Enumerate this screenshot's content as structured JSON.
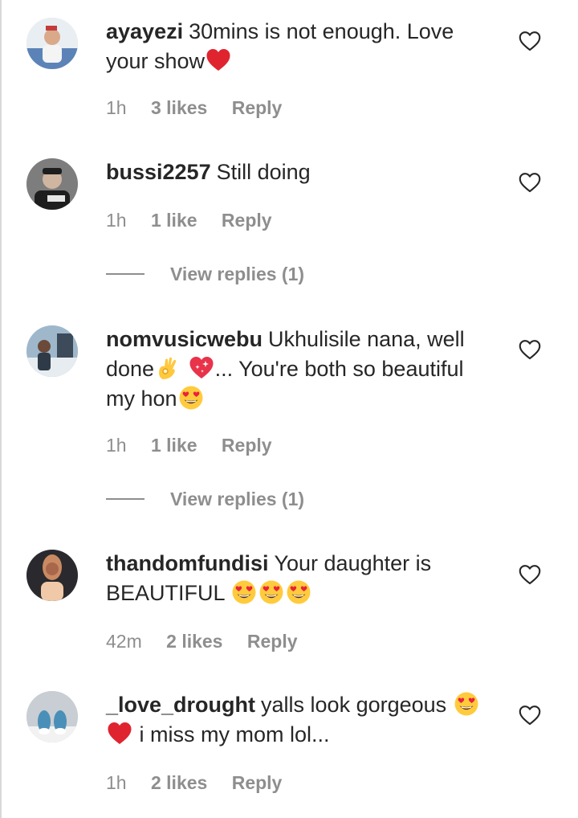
{
  "comments": [
    {
      "username": "ayayezi",
      "text_parts": [
        "30mins is not enough. Love your show"
      ],
      "time": "1h",
      "likes": "3 likes",
      "reply": "Reply",
      "avatar_colors": [
        "#e9eef3",
        "#c43b3b",
        "#5c83b8"
      ]
    },
    {
      "username": "bussi2257",
      "text_parts": [
        "Still doing"
      ],
      "time": "1h",
      "likes": "1 like",
      "reply": "Reply",
      "view_replies": "View replies (1)",
      "avatar_colors": [
        "#7d7d7d",
        "#1e1e1e",
        "#e6e6e6"
      ]
    },
    {
      "username": "nomvusicwebu",
      "text_parts": [
        "Ukhulisile nana, well done",
        "... You're both so beautiful my hon"
      ],
      "time": "1h",
      "likes": "1 like",
      "reply": "Reply",
      "view_replies": "View replies (1)",
      "avatar_colors": [
        "#9fb7cb",
        "#3d4a5a",
        "#e7ecf0"
      ]
    },
    {
      "username": "thandomfundisi",
      "text_parts": [
        "Your daughter is BEAUTIFUL"
      ],
      "time": "42m",
      "likes": "2 likes",
      "reply": "Reply",
      "avatar_colors": [
        "#2a2a2e",
        "#c98a63",
        "#f0c9a8"
      ]
    },
    {
      "username": "_love_drought",
      "text_parts": [
        "yalls look gorgeous",
        "i miss my mom lol..."
      ],
      "time": "1h",
      "likes": "2 likes",
      "reply": "Reply",
      "avatar_colors": [
        "#c8ced3",
        "#4a8fb8",
        "#f2f2f2"
      ]
    }
  ],
  "icons": {
    "like": "heart-outline-icon",
    "red_heart": "red-heart-emoji",
    "ok_hand": "ok-hand-emoji",
    "sparkling_heart": "sparkling-heart-emoji",
    "heart_eyes": "heart-eyes-emoji"
  },
  "colors": {
    "text": "#262626",
    "secondary": "#8e8e8e",
    "heart_red": "#e0242f",
    "emoji_yellow": "#ffcb3d"
  }
}
